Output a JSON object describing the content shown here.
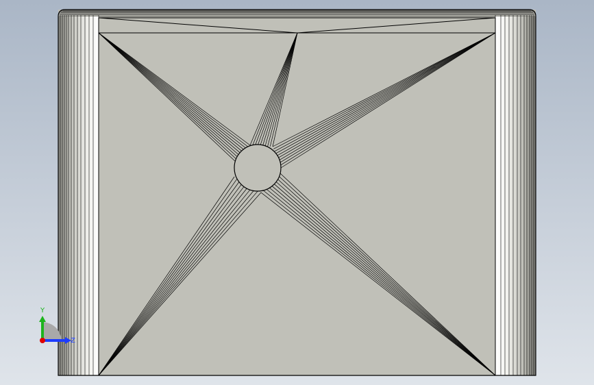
{
  "viewport": {
    "background_top": "#aab6c6",
    "background_bottom": "#dfe4ea",
    "face_color": "#c0c0b8",
    "edge_color": "#000000"
  },
  "triad": {
    "y_label": "Y",
    "z_label": "Z",
    "y_color": "#1db41d",
    "z_color": "#1d3cff",
    "origin_color": "#e00000"
  }
}
